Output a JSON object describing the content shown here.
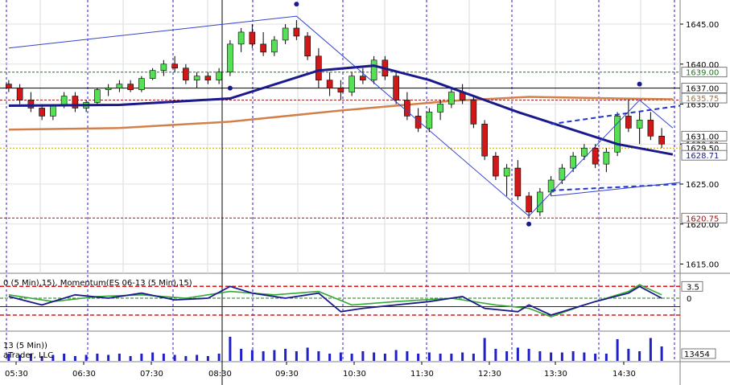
{
  "app": {
    "momentum_legend": "0 (5 Min),15), Momentum(ES 06-13 (5 Min),15)",
    "volume_legend_line1": "13 (5 Min))",
    "volume_legend_line2": "aTrader, LLC",
    "time_labels": [
      "05:30",
      "06:30",
      "07:30",
      "08:30",
      "09:30",
      "10:30",
      "11:30",
      "12:30",
      "13:30",
      "14:30"
    ],
    "price_ticks": [
      "1645.00",
      "1640.00",
      "1635.00",
      "1630.00",
      "1625.00",
      "1620.00",
      "1615.00"
    ],
    "price_markers": [
      {
        "label": "1639.00",
        "color": "#1a7a1a"
      },
      {
        "label": "1637.00",
        "color": "#000000"
      },
      {
        "label": "1635.75",
        "color": "#b07030"
      },
      {
        "label": "1631.00",
        "color": "#000000"
      },
      {
        "label": "1629.50",
        "color": "#000000"
      },
      {
        "label": "1628.71",
        "color": "#1a1a80"
      },
      {
        "label": "1620.75",
        "color": "#a01010"
      }
    ],
    "momentum_marker": "3.5",
    "momentum_zero": "0",
    "volume_marker": "13454"
  },
  "chart_data": {
    "type": "candlestick",
    "interval": "5 Min",
    "ylim": [
      1614,
      1647
    ],
    "candles": [
      [
        1637.5,
        1638.0,
        1636.5,
        1637.0
      ],
      [
        1637.0,
        1637.5,
        1635.0,
        1635.5
      ],
      [
        1635.5,
        1636.5,
        1634.0,
        1634.5
      ],
      [
        1634.5,
        1635.0,
        1633.0,
        1633.5
      ],
      [
        1633.5,
        1635.0,
        1633.0,
        1634.8
      ],
      [
        1634.8,
        1636.5,
        1634.5,
        1636.0
      ],
      [
        1636.0,
        1636.5,
        1634.0,
        1634.5
      ],
      [
        1634.5,
        1635.5,
        1634.0,
        1635.2
      ],
      [
        1635.2,
        1637.0,
        1635.0,
        1636.8
      ],
      [
        1636.8,
        1637.5,
        1636.0,
        1637.0
      ],
      [
        1637.0,
        1638.0,
        1636.5,
        1637.5
      ],
      [
        1637.5,
        1638.0,
        1636.5,
        1636.8
      ],
      [
        1636.8,
        1638.5,
        1636.5,
        1638.2
      ],
      [
        1638.2,
        1639.5,
        1638.0,
        1639.2
      ],
      [
        1639.2,
        1640.5,
        1638.5,
        1640.0
      ],
      [
        1640.0,
        1641.0,
        1639.0,
        1639.5
      ],
      [
        1639.5,
        1640.0,
        1637.5,
        1638.0
      ],
      [
        1638.0,
        1639.0,
        1637.0,
        1638.5
      ],
      [
        1638.5,
        1639.0,
        1637.5,
        1638.0
      ],
      [
        1638.0,
        1639.5,
        1637.5,
        1639.0
      ],
      [
        1639.0,
        1643.0,
        1638.5,
        1642.5
      ],
      [
        1642.5,
        1644.5,
        1641.5,
        1644.0
      ],
      [
        1644.0,
        1645.0,
        1642.0,
        1642.5
      ],
      [
        1642.5,
        1644.0,
        1641.0,
        1641.5
      ],
      [
        1641.5,
        1643.5,
        1641.0,
        1643.0
      ],
      [
        1643.0,
        1645.0,
        1642.5,
        1644.5
      ],
      [
        1644.5,
        1645.5,
        1643.0,
        1643.5
      ],
      [
        1643.5,
        1644.0,
        1640.5,
        1641.0
      ],
      [
        1641.0,
        1642.0,
        1637.0,
        1638.0
      ],
      [
        1638.0,
        1639.0,
        1636.0,
        1637.0
      ],
      [
        1637.0,
        1638.0,
        1635.5,
        1636.5
      ],
      [
        1636.5,
        1639.0,
        1636.0,
        1638.5
      ],
      [
        1638.5,
        1639.5,
        1637.5,
        1638.0
      ],
      [
        1638.0,
        1641.0,
        1637.5,
        1640.5
      ],
      [
        1640.5,
        1641.0,
        1638.0,
        1638.5
      ],
      [
        1638.5,
        1639.0,
        1635.0,
        1635.5
      ],
      [
        1635.5,
        1636.5,
        1633.0,
        1633.5
      ],
      [
        1633.5,
        1634.5,
        1631.5,
        1632.0
      ],
      [
        1632.0,
        1634.5,
        1631.5,
        1634.0
      ],
      [
        1634.0,
        1635.5,
        1633.0,
        1635.0
      ],
      [
        1635.0,
        1637.0,
        1634.5,
        1636.5
      ],
      [
        1636.5,
        1637.5,
        1635.0,
        1635.5
      ],
      [
        1635.5,
        1636.0,
        1632.0,
        1632.5
      ],
      [
        1632.5,
        1633.0,
        1628.0,
        1628.5
      ],
      [
        1628.5,
        1629.0,
        1625.5,
        1626.0
      ],
      [
        1626.0,
        1627.5,
        1623.5,
        1627.0
      ],
      [
        1627.0,
        1628.0,
        1623.0,
        1623.5
      ],
      [
        1623.5,
        1624.0,
        1620.75,
        1621.5
      ],
      [
        1621.5,
        1624.5,
        1621.0,
        1624.0
      ],
      [
        1624.0,
        1626.0,
        1623.5,
        1625.5
      ],
      [
        1625.5,
        1627.5,
        1625.0,
        1627.0
      ],
      [
        1627.0,
        1629.0,
        1626.5,
        1628.5
      ],
      [
        1628.5,
        1630.0,
        1628.0,
        1629.5
      ],
      [
        1629.5,
        1630.0,
        1627.0,
        1627.5
      ],
      [
        1627.5,
        1629.5,
        1626.5,
        1629.0
      ],
      [
        1629.0,
        1634.0,
        1628.5,
        1633.5
      ],
      [
        1633.5,
        1635.5,
        1631.5,
        1632.0
      ],
      [
        1632.0,
        1634.0,
        1630.0,
        1633.0
      ],
      [
        1633.0,
        1634.0,
        1630.5,
        1631.0
      ],
      [
        1631.0,
        1632.0,
        1629.5,
        1630.0
      ]
    ],
    "ma_fast": [
      [
        0,
        1634.8
      ],
      [
        10,
        1634.9
      ],
      [
        20,
        1635.7
      ],
      [
        28,
        1639.2
      ],
      [
        33,
        1639.8
      ],
      [
        38,
        1638.0
      ],
      [
        46,
        1634.0
      ],
      [
        55,
        1630.0
      ],
      [
        60,
        1628.7
      ]
    ],
    "ma_slow": [
      [
        0,
        1631.8
      ],
      [
        10,
        1632.0
      ],
      [
        20,
        1632.8
      ],
      [
        30,
        1634.2
      ],
      [
        40,
        1635.4
      ],
      [
        47,
        1635.9
      ],
      [
        55,
        1635.7
      ],
      [
        60,
        1635.6
      ]
    ],
    "momentum": [
      [
        0,
        0.5
      ],
      [
        3,
        -2
      ],
      [
        6,
        1
      ],
      [
        9,
        0
      ],
      [
        12,
        1.5
      ],
      [
        15,
        -0.5
      ],
      [
        18,
        0
      ],
      [
        20,
        3.5
      ],
      [
        22,
        1.5
      ],
      [
        25,
        0
      ],
      [
        28,
        1.5
      ],
      [
        30,
        -4
      ],
      [
        32,
        -3
      ],
      [
        35,
        -2
      ],
      [
        38,
        -1
      ],
      [
        41,
        0.5
      ],
      [
        43,
        -3
      ],
      [
        46,
        -4
      ],
      [
        47,
        -2
      ],
      [
        49,
        -5
      ],
      [
        50,
        -4
      ],
      [
        53,
        -1
      ],
      [
        56,
        1.5
      ],
      [
        57,
        3.5
      ],
      [
        59,
        0
      ]
    ],
    "momentum2": [
      [
        0,
        1
      ],
      [
        4,
        -1
      ],
      [
        8,
        0.5
      ],
      [
        12,
        1
      ],
      [
        16,
        0
      ],
      [
        20,
        2
      ],
      [
        24,
        1
      ],
      [
        28,
        2
      ],
      [
        31,
        -2
      ],
      [
        35,
        -1
      ],
      [
        40,
        0
      ],
      [
        44,
        -2
      ],
      [
        47,
        -3
      ],
      [
        49,
        -5.5
      ],
      [
        52,
        -2
      ],
      [
        56,
        2
      ],
      [
        57,
        4
      ],
      [
        59,
        1
      ]
    ],
    "volume": [
      0.3,
      0.25,
      0.3,
      0.2,
      0.25,
      0.3,
      0.2,
      0.25,
      0.3,
      0.25,
      0.3,
      0.2,
      0.3,
      0.35,
      0.3,
      0.25,
      0.2,
      0.25,
      0.2,
      0.3,
      1.0,
      0.5,
      0.45,
      0.4,
      0.45,
      0.5,
      0.4,
      0.55,
      0.4,
      0.3,
      0.35,
      0.3,
      0.4,
      0.35,
      0.3,
      0.45,
      0.4,
      0.3,
      0.35,
      0.3,
      0.3,
      0.35,
      0.3,
      0.95,
      0.5,
      0.4,
      0.55,
      0.5,
      0.4,
      0.35,
      0.35,
      0.4,
      0.35,
      0.3,
      0.3,
      0.9,
      0.5,
      0.4,
      0.95,
      0.6
    ]
  }
}
